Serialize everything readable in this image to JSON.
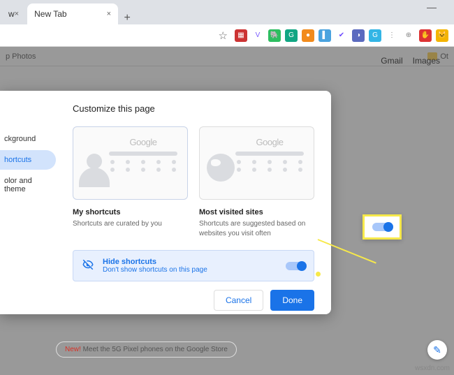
{
  "tabs": {
    "first_close": "×",
    "active": "New Tab",
    "active_close": "×",
    "plus": "+"
  },
  "window": {
    "min": "—",
    "max": "□",
    "close": "×"
  },
  "toolbar": {
    "star": "☆"
  },
  "bookmarks": {
    "photos": "p Photos",
    "other": "Ot"
  },
  "toplinks": {
    "gmail": "Gmail",
    "images": "Images"
  },
  "dialog": {
    "title": "Customize this page",
    "sidebar": {
      "background": "ckground",
      "shortcuts": "hortcuts",
      "color": "olor and theme"
    },
    "card1": {
      "logo": "Google",
      "title": "My shortcuts",
      "desc": "Shortcuts are curated by you"
    },
    "card2": {
      "logo": "Google",
      "title": "Most visited sites",
      "desc": "Shortcuts are suggested based on websites you visit often"
    },
    "hide": {
      "title": "Hide shortcuts",
      "desc": "Don't show shortcuts on this page"
    },
    "cancel": "Cancel",
    "done": "Done"
  },
  "promo": {
    "new": "New!",
    "msg": " Meet the 5G Pixel phones on the Google Store"
  },
  "edit": "✎",
  "watermark": "wsxdn.com"
}
